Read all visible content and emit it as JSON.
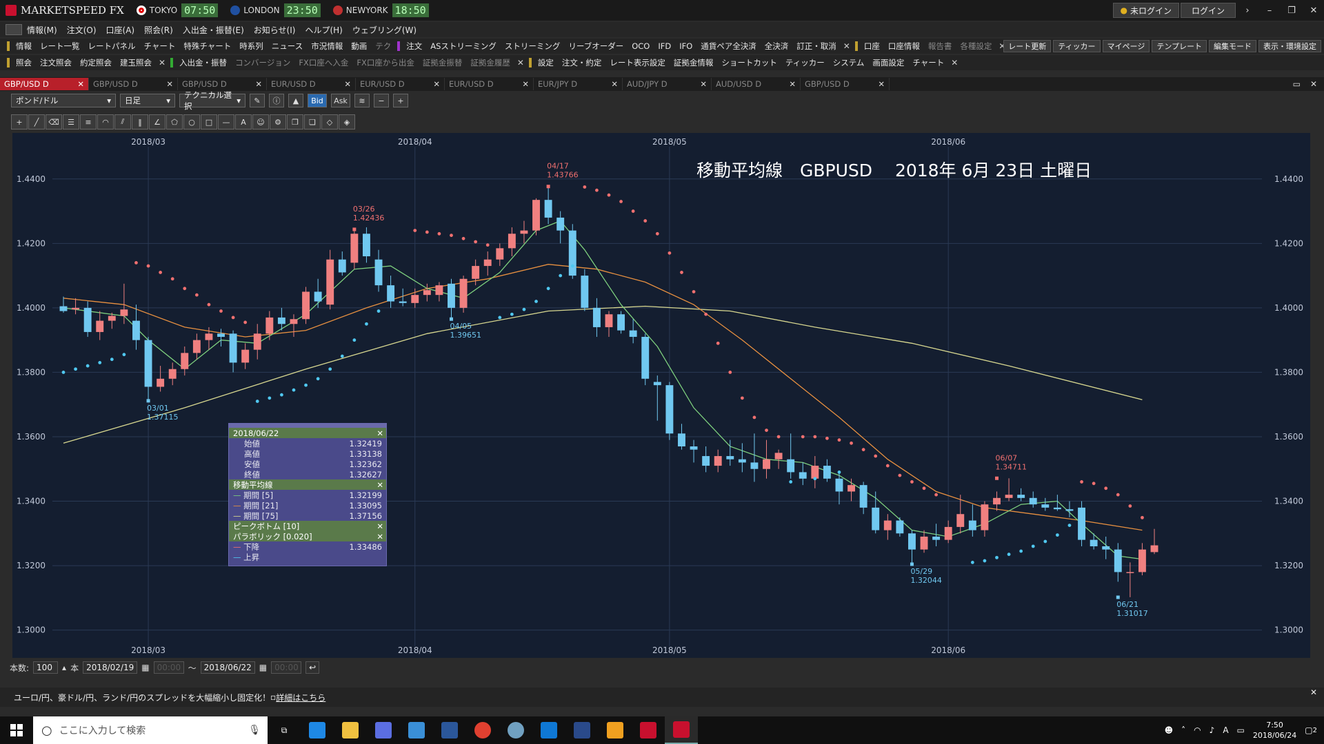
{
  "app": {
    "title": "MARKETSPEED FX",
    "clocks": [
      {
        "city": "TOKYO",
        "time": "07:50",
        "flag_color": "#e00000"
      },
      {
        "city": "LONDON",
        "time": "23:50",
        "flag_color": "#2050a0"
      },
      {
        "city": "NEWYORK",
        "time": "18:50",
        "flag_color": "#c03030"
      }
    ],
    "login_status": "未ログイン",
    "login_button": "ログイン"
  },
  "menu": [
    "情報(M)",
    "注文(O)",
    "口座(A)",
    "照会(R)",
    "入出金・振替(E)",
    "お知らせ(I)",
    "ヘルプ(H)",
    "ウェブリング(W)"
  ],
  "toolbar1": {
    "group_label": "情報",
    "items": [
      "レート一覧",
      "レートパネル",
      "チャート",
      "特殊チャート",
      "時系列",
      "ニュース",
      "市況情報",
      "動画",
      "テク"
    ],
    "order_label": "注文",
    "order_items": [
      "ASストリーミング",
      "ストリーミング",
      "リーブオーダー",
      "OCO",
      "IFD",
      "IFO",
      "通貨ペア全決済",
      "全決済",
      "訂正・取消"
    ],
    "account_label": "口座",
    "account_items": [
      "口座情報",
      "報告書",
      "各種設定"
    ],
    "right_buttons": [
      "レート更新",
      "ティッカー",
      "マイページ",
      "テンプレート",
      "編集モード",
      "表示・環境設定"
    ]
  },
  "toolbar2": {
    "group_label": "照会",
    "items": [
      "注文照会",
      "約定照会",
      "建玉照会"
    ],
    "transfer_label": "入出金・振替",
    "transfer_items": [
      "コンバージョン",
      "FX口座へ入金",
      "FX口座から出金",
      "証拠金振替",
      "証拠金履歴"
    ],
    "settings_label": "設定",
    "settings_items": [
      "注文・約定",
      "レート表示設定",
      "証拠金情報",
      "ショートカット",
      "ティッカー",
      "システム",
      "画面設定",
      "チャート"
    ]
  },
  "tabs": [
    "GBP/USD D",
    "GBP/USD D",
    "GBP/USD D",
    "EUR/USD D",
    "EUR/USD D",
    "EUR/USD D",
    "EUR/JPY D",
    "AUD/JPY D",
    "AUD/USD D",
    "GBP/USD D"
  ],
  "chart_controls": {
    "pair": "ポンド/ドル",
    "timeframe": "日足",
    "technical": "テクニカル選択",
    "bid": "Bid",
    "ask": "Ask"
  },
  "chart_title": "移動平均線　GBPUSD　 2018年 6月 23日 土曜日",
  "info_box": {
    "date": "2018/06/22",
    "ohlc": [
      {
        "label": "始値",
        "value": "1.32419"
      },
      {
        "label": "高値",
        "value": "1.33138"
      },
      {
        "label": "安値",
        "value": "1.32362"
      },
      {
        "label": "終値",
        "value": "1.32627"
      }
    ],
    "ma_title": "移動平均線",
    "ma": [
      {
        "label": "期間 [5]",
        "value": "1.32199",
        "color": "#7ed07e"
      },
      {
        "label": "期間 [21]",
        "value": "1.33095",
        "color": "#e89040"
      },
      {
        "label": "期間 [75]",
        "value": "1.37156",
        "color": "#d8d890"
      }
    ],
    "peak_title": "ピークボトム [10]",
    "sar_title": "パラボリック [0.020]",
    "sar": [
      {
        "label": "下降",
        "value": "1.33486",
        "color": "#f07070"
      },
      {
        "label": "上昇",
        "value": "",
        "color": "#50c8f0"
      }
    ]
  },
  "footer": {
    "count_label": "本数:",
    "count": "100",
    "unit": "本",
    "from_date": "2018/02/19",
    "from_time": "00:00",
    "tilde": "～",
    "to_date": "2018/06/22",
    "to_time": "00:00"
  },
  "news": {
    "text": "ユーロ/円、豪ドル/円、ランド/円のスプレッドを大幅縮小し固定化！",
    "link": "詳細はこちら"
  },
  "taskbar": {
    "search_placeholder": "ここに入力して検索",
    "time": "7:50",
    "date": "2018/06/24",
    "ime": "A",
    "notify_count": "2"
  },
  "colors": {
    "chart_bg": "#141e30",
    "up_candle": "#f08080",
    "down_candle": "#70c8f0",
    "ma5": "#7ed07e",
    "ma21": "#e89040",
    "ma75": "#d8d890",
    "sar_down": "#f07070",
    "sar_up": "#50c8f0",
    "active_tab": "#b8202a"
  },
  "chart_data": {
    "type": "candlestick",
    "x_tick_labels": [
      "2018/03",
      "2018/04",
      "2018/05",
      "2018/06"
    ],
    "x_tick_index": [
      7,
      29,
      50,
      73
    ],
    "y_ticks": [
      "1.4400",
      "1.4200",
      "1.4000",
      "1.3800",
      "1.3600",
      "1.3400",
      "1.3200",
      "1.3000"
    ],
    "ylim": [
      1.295,
      1.45
    ],
    "grid": true,
    "annotations": [
      {
        "date": "03/01",
        "value": "1.37115",
        "i": 7,
        "price": 1.37115,
        "kind": "low"
      },
      {
        "date": "03/26",
        "value": "1.42436",
        "i": 24,
        "price": 1.42436,
        "kind": "high"
      },
      {
        "date": "04/05",
        "value": "1.39651",
        "i": 32,
        "price": 1.39651,
        "kind": "low"
      },
      {
        "date": "04/17",
        "value": "1.43766",
        "i": 40,
        "price": 1.43766,
        "kind": "high"
      },
      {
        "date": "05/29",
        "value": "1.32044",
        "i": 70,
        "price": 1.32044,
        "kind": "low"
      },
      {
        "date": "06/07",
        "value": "1.34711",
        "i": 77,
        "price": 1.34711,
        "kind": "high"
      },
      {
        "date": "06/21",
        "value": "1.31017",
        "i": 87,
        "price": 1.31017,
        "kind": "low"
      }
    ],
    "candles": [
      [
        1.4005,
        1.4035,
        1.3985,
        1.399
      ],
      [
        1.3995,
        1.403,
        1.398,
        1.4
      ],
      [
        1.4,
        1.402,
        1.391,
        1.3925
      ],
      [
        1.3925,
        1.399,
        1.39,
        1.396
      ],
      [
        1.396,
        1.3985,
        1.3935,
        1.3975
      ],
      [
        1.3975,
        1.4075,
        1.395,
        1.3995
      ],
      [
        1.396,
        1.401,
        1.387,
        1.39
      ],
      [
        1.39,
        1.391,
        1.3712,
        1.3755
      ],
      [
        1.3755,
        1.382,
        1.374,
        1.378
      ],
      [
        1.378,
        1.383,
        1.376,
        1.381
      ],
      [
        1.381,
        1.388,
        1.379,
        1.386
      ],
      [
        1.386,
        1.392,
        1.384,
        1.39
      ],
      [
        1.39,
        1.394,
        1.387,
        1.392
      ],
      [
        1.392,
        1.3935,
        1.388,
        1.391
      ],
      [
        1.392,
        1.393,
        1.38,
        1.383
      ],
      [
        1.383,
        1.389,
        1.381,
        1.387
      ],
      [
        1.387,
        1.395,
        1.384,
        1.392
      ],
      [
        1.392,
        1.399,
        1.39,
        1.397
      ],
      [
        1.397,
        1.4,
        1.393,
        1.395
      ],
      [
        1.395,
        1.398,
        1.391,
        1.3965
      ],
      [
        1.3965,
        1.4065,
        1.395,
        1.405
      ],
      [
        1.405,
        1.409,
        1.4,
        1.402
      ],
      [
        1.401,
        1.418,
        1.3995,
        1.415
      ],
      [
        1.415,
        1.4175,
        1.41,
        1.411
      ],
      [
        1.414,
        1.4244,
        1.412,
        1.423
      ],
      [
        1.423,
        1.425,
        1.414,
        1.416
      ],
      [
        1.415,
        1.418,
        1.405,
        1.407
      ],
      [
        1.407,
        1.41,
        1.4,
        1.402
      ],
      [
        1.402,
        1.406,
        1.4005,
        1.4015
      ],
      [
        1.4015,
        1.406,
        1.4,
        1.404
      ],
      [
        1.404,
        1.4075,
        1.402,
        1.4055
      ],
      [
        1.404,
        1.408,
        1.402,
        1.407
      ],
      [
        1.4075,
        1.409,
        1.3965,
        1.4
      ],
      [
        1.4,
        1.41,
        1.3985,
        1.409
      ],
      [
        1.409,
        1.415,
        1.407,
        1.413
      ],
      [
        1.413,
        1.4175,
        1.41,
        1.415
      ],
      [
        1.415,
        1.42,
        1.413,
        1.4185
      ],
      [
        1.4185,
        1.425,
        1.416,
        1.423
      ],
      [
        1.423,
        1.427,
        1.42,
        1.424
      ],
      [
        1.424,
        1.434,
        1.4225,
        1.4335
      ],
      [
        1.4335,
        1.4377,
        1.426,
        1.428
      ],
      [
        1.428,
        1.43,
        1.42,
        1.424
      ],
      [
        1.424,
        1.426,
        1.409,
        1.41
      ],
      [
        1.41,
        1.412,
        1.399,
        1.4
      ],
      [
        1.4,
        1.403,
        1.391,
        1.394
      ],
      [
        1.394,
        1.399,
        1.391,
        1.398
      ],
      [
        1.398,
        1.399,
        1.392,
        1.393
      ],
      [
        1.393,
        1.3965,
        1.389,
        1.391
      ],
      [
        1.391,
        1.392,
        1.376,
        1.378
      ],
      [
        1.377,
        1.379,
        1.365,
        1.376
      ],
      [
        1.376,
        1.377,
        1.359,
        1.361
      ],
      [
        1.361,
        1.364,
        1.356,
        1.357
      ],
      [
        1.357,
        1.359,
        1.352,
        1.356
      ],
      [
        1.354,
        1.357,
        1.349,
        1.351
      ],
      [
        1.351,
        1.356,
        1.349,
        1.354
      ],
      [
        1.354,
        1.359,
        1.351,
        1.353
      ],
      [
        1.353,
        1.358,
        1.349,
        1.352
      ],
      [
        1.352,
        1.361,
        1.346,
        1.35
      ],
      [
        1.35,
        1.359,
        1.347,
        1.353
      ],
      [
        1.353,
        1.356,
        1.35,
        1.355
      ],
      [
        1.353,
        1.361,
        1.347,
        1.349
      ],
      [
        1.349,
        1.352,
        1.345,
        1.347
      ],
      [
        1.347,
        1.354,
        1.344,
        1.351
      ],
      [
        1.351,
        1.353,
        1.346,
        1.347
      ],
      [
        1.347,
        1.349,
        1.339,
        1.343
      ],
      [
        1.343,
        1.347,
        1.34,
        1.345
      ],
      [
        1.345,
        1.346,
        1.336,
        1.338
      ],
      [
        1.338,
        1.343,
        1.33,
        1.331
      ],
      [
        1.331,
        1.336,
        1.328,
        1.334
      ],
      [
        1.334,
        1.335,
        1.329,
        1.33
      ],
      [
        1.33,
        1.331,
        1.3204,
        1.325
      ],
      [
        1.325,
        1.331,
        1.324,
        1.329
      ],
      [
        1.329,
        1.333,
        1.326,
        1.328
      ],
      [
        1.328,
        1.334,
        1.327,
        1.332
      ],
      [
        1.332,
        1.342,
        1.33,
        1.336
      ],
      [
        1.334,
        1.339,
        1.329,
        1.331
      ],
      [
        1.331,
        1.34,
        1.329,
        1.339
      ],
      [
        1.339,
        1.343,
        1.337,
        1.341
      ],
      [
        1.341,
        1.3471,
        1.34,
        1.342
      ],
      [
        1.342,
        1.344,
        1.34,
        1.341
      ],
      [
        1.341,
        1.343,
        1.338,
        1.339
      ],
      [
        1.339,
        1.341,
        1.337,
        1.338
      ],
      [
        1.338,
        1.342,
        1.337,
        1.3375
      ],
      [
        1.3375,
        1.34,
        1.335,
        1.337
      ],
      [
        1.338,
        1.34,
        1.326,
        1.328
      ],
      [
        1.328,
        1.33,
        1.325,
        1.326
      ],
      [
        1.326,
        1.329,
        1.322,
        1.325
      ],
      [
        1.325,
        1.327,
        1.315,
        1.318
      ],
      [
        1.318,
        1.321,
        1.3102,
        1.318
      ],
      [
        1.318,
        1.327,
        1.317,
        1.325
      ],
      [
        1.3242,
        1.3314,
        1.3236,
        1.3263
      ]
    ],
    "ma5": [
      [
        0,
        1.4
      ],
      [
        5,
        1.3975
      ],
      [
        7,
        1.39
      ],
      [
        10,
        1.381
      ],
      [
        13,
        1.39
      ],
      [
        16,
        1.389
      ],
      [
        20,
        1.398
      ],
      [
        24,
        1.412
      ],
      [
        27,
        1.413
      ],
      [
        30,
        1.406
      ],
      [
        33,
        1.403
      ],
      [
        36,
        1.411
      ],
      [
        39,
        1.424
      ],
      [
        41,
        1.427
      ],
      [
        43,
        1.418
      ],
      [
        46,
        1.401
      ],
      [
        49,
        1.388
      ],
      [
        52,
        1.369
      ],
      [
        55,
        1.357
      ],
      [
        58,
        1.353
      ],
      [
        61,
        1.352
      ],
      [
        64,
        1.348
      ],
      [
        67,
        1.341
      ],
      [
        70,
        1.331
      ],
      [
        73,
        1.329
      ],
      [
        76,
        1.333
      ],
      [
        79,
        1.339
      ],
      [
        82,
        1.34
      ],
      [
        84,
        1.333
      ],
      [
        87,
        1.323
      ],
      [
        89,
        1.322
      ]
    ],
    "ma21": [
      [
        0,
        1.403
      ],
      [
        5,
        1.401
      ],
      [
        10,
        1.394
      ],
      [
        15,
        1.391
      ],
      [
        20,
        1.393
      ],
      [
        25,
        1.4
      ],
      [
        30,
        1.406
      ],
      [
        35,
        1.409
      ],
      [
        40,
        1.4135
      ],
      [
        44,
        1.412
      ],
      [
        48,
        1.408
      ],
      [
        52,
        1.401
      ],
      [
        56,
        1.39
      ],
      [
        60,
        1.378
      ],
      [
        64,
        1.366
      ],
      [
        68,
        1.353
      ],
      [
        72,
        1.343
      ],
      [
        76,
        1.338
      ],
      [
        80,
        1.336
      ],
      [
        84,
        1.334
      ],
      [
        89,
        1.331
      ]
    ],
    "ma75": [
      [
        0,
        1.358
      ],
      [
        10,
        1.369
      ],
      [
        20,
        1.381
      ],
      [
        30,
        1.392
      ],
      [
        40,
        1.399
      ],
      [
        48,
        1.4005
      ],
      [
        55,
        1.399
      ],
      [
        62,
        1.394
      ],
      [
        70,
        1.389
      ],
      [
        78,
        1.382
      ],
      [
        89,
        1.3715
      ]
    ],
    "sar": [
      [
        6,
        1.414,
        "d"
      ],
      [
        7,
        1.413,
        "d"
      ],
      [
        8,
        1.411,
        "d"
      ],
      [
        9,
        1.409,
        "d"
      ],
      [
        10,
        1.406,
        "d"
      ],
      [
        11,
        1.404,
        "d"
      ],
      [
        12,
        1.401,
        "d"
      ],
      [
        13,
        1.399,
        "d"
      ],
      [
        14,
        1.397,
        "d"
      ],
      [
        15,
        1.3955,
        "d"
      ],
      [
        0,
        1.38,
        "u"
      ],
      [
        1,
        1.381,
        "u"
      ],
      [
        2,
        1.382,
        "u"
      ],
      [
        3,
        1.383,
        "u"
      ],
      [
        4,
        1.384,
        "u"
      ],
      [
        5,
        1.3855,
        "u"
      ],
      [
        16,
        1.371,
        "u"
      ],
      [
        17,
        1.372,
        "u"
      ],
      [
        18,
        1.373,
        "u"
      ],
      [
        19,
        1.3745,
        "u"
      ],
      [
        20,
        1.376,
        "u"
      ],
      [
        21,
        1.378,
        "u"
      ],
      [
        22,
        1.381,
        "u"
      ],
      [
        23,
        1.385,
        "u"
      ],
      [
        24,
        1.39,
        "u"
      ],
      [
        25,
        1.395,
        "u"
      ],
      [
        26,
        1.399,
        "u"
      ],
      [
        29,
        1.424,
        "d"
      ],
      [
        30,
        1.4235,
        "d"
      ],
      [
        31,
        1.423,
        "d"
      ],
      [
        32,
        1.4225,
        "d"
      ],
      [
        33,
        1.4215,
        "d"
      ],
      [
        34,
        1.4205,
        "d"
      ],
      [
        35,
        1.4195,
        "d"
      ],
      [
        36,
        1.397,
        "u"
      ],
      [
        37,
        1.398,
        "u"
      ],
      [
        38,
        1.3995,
        "u"
      ],
      [
        39,
        1.402,
        "u"
      ],
      [
        40,
        1.406,
        "u"
      ],
      [
        41,
        1.41,
        "u"
      ],
      [
        42,
        1.413,
        "u"
      ],
      [
        43,
        1.4375,
        "d"
      ],
      [
        44,
        1.4365,
        "d"
      ],
      [
        45,
        1.435,
        "d"
      ],
      [
        46,
        1.433,
        "d"
      ],
      [
        47,
        1.43,
        "d"
      ],
      [
        48,
        1.427,
        "d"
      ],
      [
        49,
        1.423,
        "d"
      ],
      [
        50,
        1.417,
        "d"
      ],
      [
        51,
        1.411,
        "d"
      ],
      [
        52,
        1.405,
        "d"
      ],
      [
        53,
        1.398,
        "d"
      ],
      [
        54,
        1.389,
        "d"
      ],
      [
        55,
        1.38,
        "d"
      ],
      [
        56,
        1.372,
        "d"
      ],
      [
        57,
        1.366,
        "d"
      ],
      [
        58,
        1.362,
        "d"
      ],
      [
        59,
        1.36,
        "d"
      ],
      [
        61,
        1.36,
        "d"
      ],
      [
        62,
        1.36,
        "d"
      ],
      [
        63,
        1.3595,
        "d"
      ],
      [
        64,
        1.359,
        "d"
      ],
      [
        65,
        1.358,
        "d"
      ],
      [
        66,
        1.356,
        "d"
      ],
      [
        67,
        1.354,
        "d"
      ],
      [
        68,
        1.351,
        "d"
      ],
      [
        69,
        1.348,
        "d"
      ],
      [
        70,
        1.346,
        "d"
      ],
      [
        71,
        1.344,
        "d"
      ],
      [
        72,
        1.342,
        "d"
      ],
      [
        60,
        1.346,
        "u"
      ],
      [
        62,
        1.347,
        "u"
      ],
      [
        64,
        1.349,
        "u"
      ],
      [
        75,
        1.321,
        "u"
      ],
      [
        76,
        1.3215,
        "u"
      ],
      [
        77,
        1.3225,
        "u"
      ],
      [
        78,
        1.3235,
        "u"
      ],
      [
        79,
        1.3245,
        "u"
      ],
      [
        80,
        1.326,
        "u"
      ],
      [
        81,
        1.3275,
        "u"
      ],
      [
        82,
        1.3295,
        "u"
      ],
      [
        83,
        1.3325,
        "u"
      ],
      [
        84,
        1.346,
        "d"
      ],
      [
        85,
        1.3455,
        "d"
      ],
      [
        86,
        1.344,
        "d"
      ],
      [
        87,
        1.342,
        "d"
      ],
      [
        88,
        1.3385,
        "d"
      ],
      [
        89,
        1.3349,
        "d"
      ]
    ]
  }
}
